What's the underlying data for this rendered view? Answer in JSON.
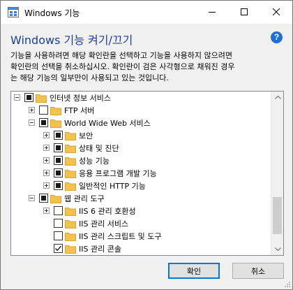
{
  "window": {
    "title": "Windows 기능"
  },
  "header": {
    "heading": "Windows 기능 켜기/끄기",
    "help_icon_label": "?",
    "description_lines": [
      "기능을 사용하려면 해당 확인란을 선택하고 기능을 사용하지 않으려면",
      "확인란의 선택을 취소하십시오. 확인란이 검은 사각형으로 채워진 경우",
      "는 해당 기능의 일부만이 사용되고 있는 것입니다."
    ]
  },
  "tree": {
    "items": [
      {
        "label": "인터넷 정보 서비스",
        "level": 0,
        "expander": "minus",
        "state": "partial"
      },
      {
        "label": "FTP 서버",
        "level": 1,
        "expander": "plus",
        "state": "unchecked"
      },
      {
        "label": "World Wide Web 서비스",
        "level": 1,
        "expander": "minus",
        "state": "partial"
      },
      {
        "label": "보안",
        "level": 2,
        "expander": "plus",
        "state": "partial"
      },
      {
        "label": "상태 및 진단",
        "level": 2,
        "expander": "plus",
        "state": "partial"
      },
      {
        "label": "성능 기능",
        "level": 2,
        "expander": "plus",
        "state": "partial"
      },
      {
        "label": "응용 프로그램 개발 기능",
        "level": 2,
        "expander": "plus",
        "state": "partial"
      },
      {
        "label": "일반적인 HTTP 기능",
        "level": 2,
        "expander": "plus",
        "state": "partial"
      },
      {
        "label": "웹 관리 도구",
        "level": 1,
        "expander": "minus",
        "state": "partial"
      },
      {
        "label": "IIS 6 관리 호환성",
        "level": 2,
        "expander": "plus",
        "state": "unchecked"
      },
      {
        "label": "IIS 관리 서비스",
        "level": 2,
        "expander": "none",
        "state": "unchecked"
      },
      {
        "label": "IIS 관리 스크립트 및 도구",
        "level": 2,
        "expander": "none",
        "state": "unchecked"
      },
      {
        "label": "IIS 관리 콘솔",
        "level": 2,
        "expander": "none",
        "state": "checked"
      },
      {
        "label": "",
        "level": 0,
        "expander": "minus",
        "state": "partial"
      }
    ]
  },
  "buttons": {
    "ok_label": "확인",
    "cancel_label": "취소"
  },
  "colors": {
    "heading": "#1c3f95",
    "accent": "#0078d7",
    "folder": "#f3c14e"
  }
}
